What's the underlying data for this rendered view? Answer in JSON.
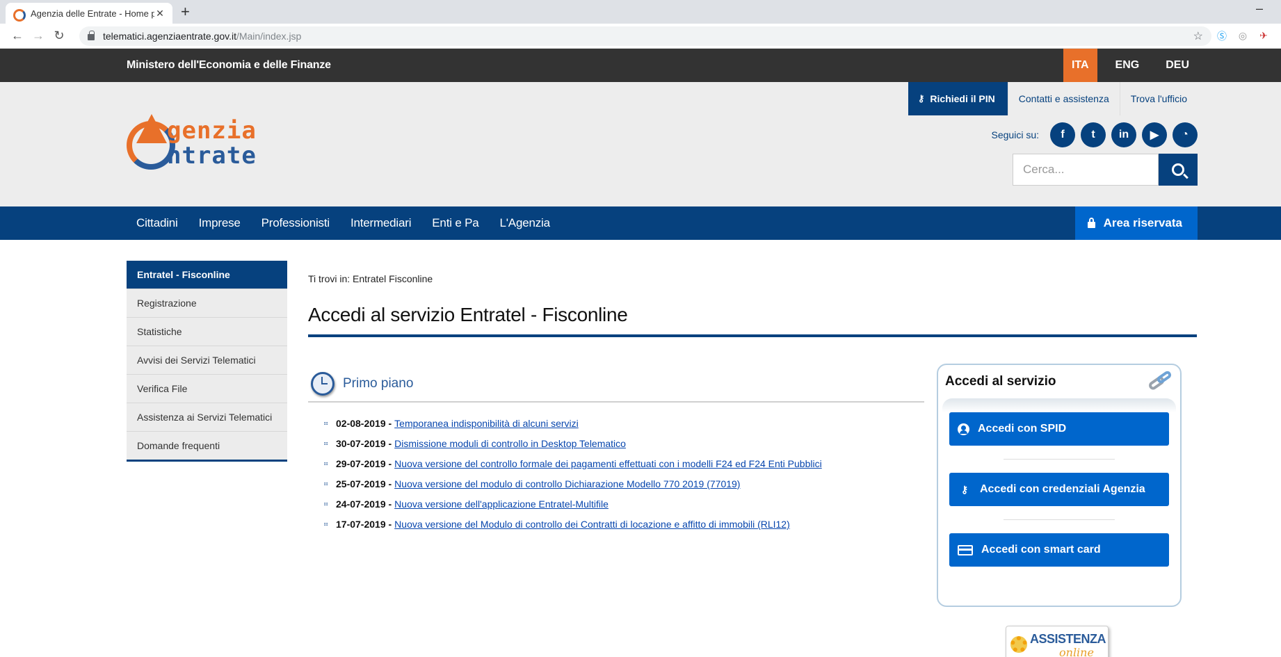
{
  "browser": {
    "tab_title": "Agenzia delle Entrate - Home pa",
    "url_host": "telematici.agenziaentrate.gov.it",
    "url_path": "/Main/index.jsp"
  },
  "topbar": {
    "ministry": "Ministero dell'Economia e delle Finanze",
    "languages": [
      "ITA",
      "ENG",
      "DEU"
    ]
  },
  "header": {
    "logo_word1": "genzia",
    "logo_word2": "ntrate",
    "pin_label": "Richiedi il PIN",
    "contact_label": "Contatti e assistenza",
    "office_label": "Trova l'ufficio",
    "follow_label": "Seguici su:",
    "social_icons": [
      "facebook-icon",
      "twitter-icon",
      "linkedin-icon",
      "youtube-icon",
      "rss-icon"
    ],
    "search_placeholder": "Cerca..."
  },
  "mainnav": {
    "items": [
      "Cittadini",
      "Imprese",
      "Professionisti",
      "Intermediari",
      "Enti e Pa",
      "L'Agenzia"
    ],
    "area_label": "Area riservata"
  },
  "sidebar": {
    "header": "Entratel - Fisconline",
    "items": [
      "Registrazione",
      "Statistiche",
      "Avvisi dei Servizi Telematici",
      "Verifica File",
      "Assistenza ai Servizi Telematici",
      "Domande frequenti"
    ]
  },
  "main": {
    "breadcrumb": "Ti trovi in: Entratel Fisconline",
    "title": "Accedi al servizio Entratel - Fisconline",
    "primo_piano": "Primo piano",
    "news": [
      {
        "date": "02-08-2019 -",
        "text": "Temporanea indisponibilità di alcuni servizi"
      },
      {
        "date": "30-07-2019 -",
        "text": "Dismissione moduli di controllo in Desktop Telematico"
      },
      {
        "date": "29-07-2019 -",
        "text": "Nuova versione del controllo formale dei pagamenti effettuati con i modelli F24 ed F24 Enti Pubblici"
      },
      {
        "date": "25-07-2019 -",
        "text": "Nuova versione del modulo di controllo Dichiarazione Modello 770 2019 (77019)"
      },
      {
        "date": "24-07-2019 -",
        "text": "Nuova versione dell'applicazione Entratel-Multifile"
      },
      {
        "date": "17-07-2019 -",
        "text": "Nuova versione del Modulo di controllo dei Contratti di locazione e affitto di immobili (RLI12)"
      }
    ]
  },
  "access": {
    "title": "Accedi al servizio",
    "spid": "Accedi con SPID",
    "credentials": "Accedi con credenziali Agenzia",
    "smartcard": "Accedi con smart card"
  },
  "assistenza": {
    "word1": "ASSISTENZA",
    "word2": "online"
  },
  "colors": {
    "brand_blue": "#06417e",
    "accent_orange": "#e8702a",
    "button_blue": "#0066cc"
  }
}
